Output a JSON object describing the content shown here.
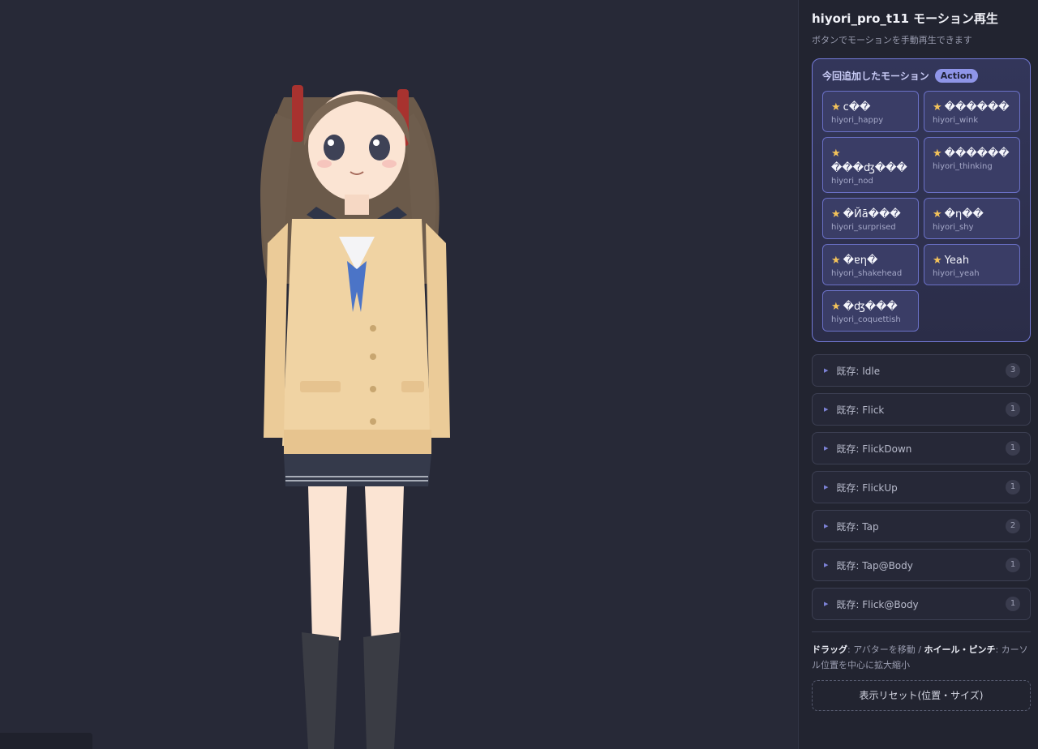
{
  "panel": {
    "title": "hiyori_pro_t11 モーション再生",
    "subtitle": "ボタンでモーションを手動再生できます"
  },
  "action_section": {
    "title": "今回追加したモーション",
    "badge": "Action",
    "star_icon": "★",
    "motions": [
      {
        "label": "c��",
        "id": "hiyori_happy"
      },
      {
        "label": "������",
        "id": "hiyori_wink"
      },
      {
        "label": "���ʤ���",
        "id": "hiyori_nod"
      },
      {
        "label": "������",
        "id": "hiyori_thinking"
      },
      {
        "label": "�Йā���",
        "id": "hiyori_surprised"
      },
      {
        "label": "�η��",
        "id": "hiyori_shy"
      },
      {
        "label": "�ɐη�",
        "id": "hiyori_shakehead"
      },
      {
        "label": "Yeah",
        "id": "hiyori_yeah"
      },
      {
        "label": "�ʤ���",
        "id": "hiyori_coquettish"
      }
    ]
  },
  "groups": [
    {
      "label": "既存: Idle",
      "count": "3"
    },
    {
      "label": "既存: Flick",
      "count": "1"
    },
    {
      "label": "既存: FlickDown",
      "count": "1"
    },
    {
      "label": "既存: FlickUp",
      "count": "1"
    },
    {
      "label": "既存: Tap",
      "count": "2"
    },
    {
      "label": "既存: Tap@Body",
      "count": "1"
    },
    {
      "label": "既存: Flick@Body",
      "count": "1"
    }
  ],
  "help": {
    "drag_label": "ドラッグ",
    "drag_text": ": アバターを移動 / ",
    "wheel_label": "ホイール・ピンチ",
    "wheel_text": ": カーソル位置を中心に拡大縮小"
  },
  "reset_button": "表示リセット(位置・サイズ)",
  "colors": {
    "background": "#272937",
    "accent": "#8f95e8",
    "star": "#f4c35a"
  }
}
